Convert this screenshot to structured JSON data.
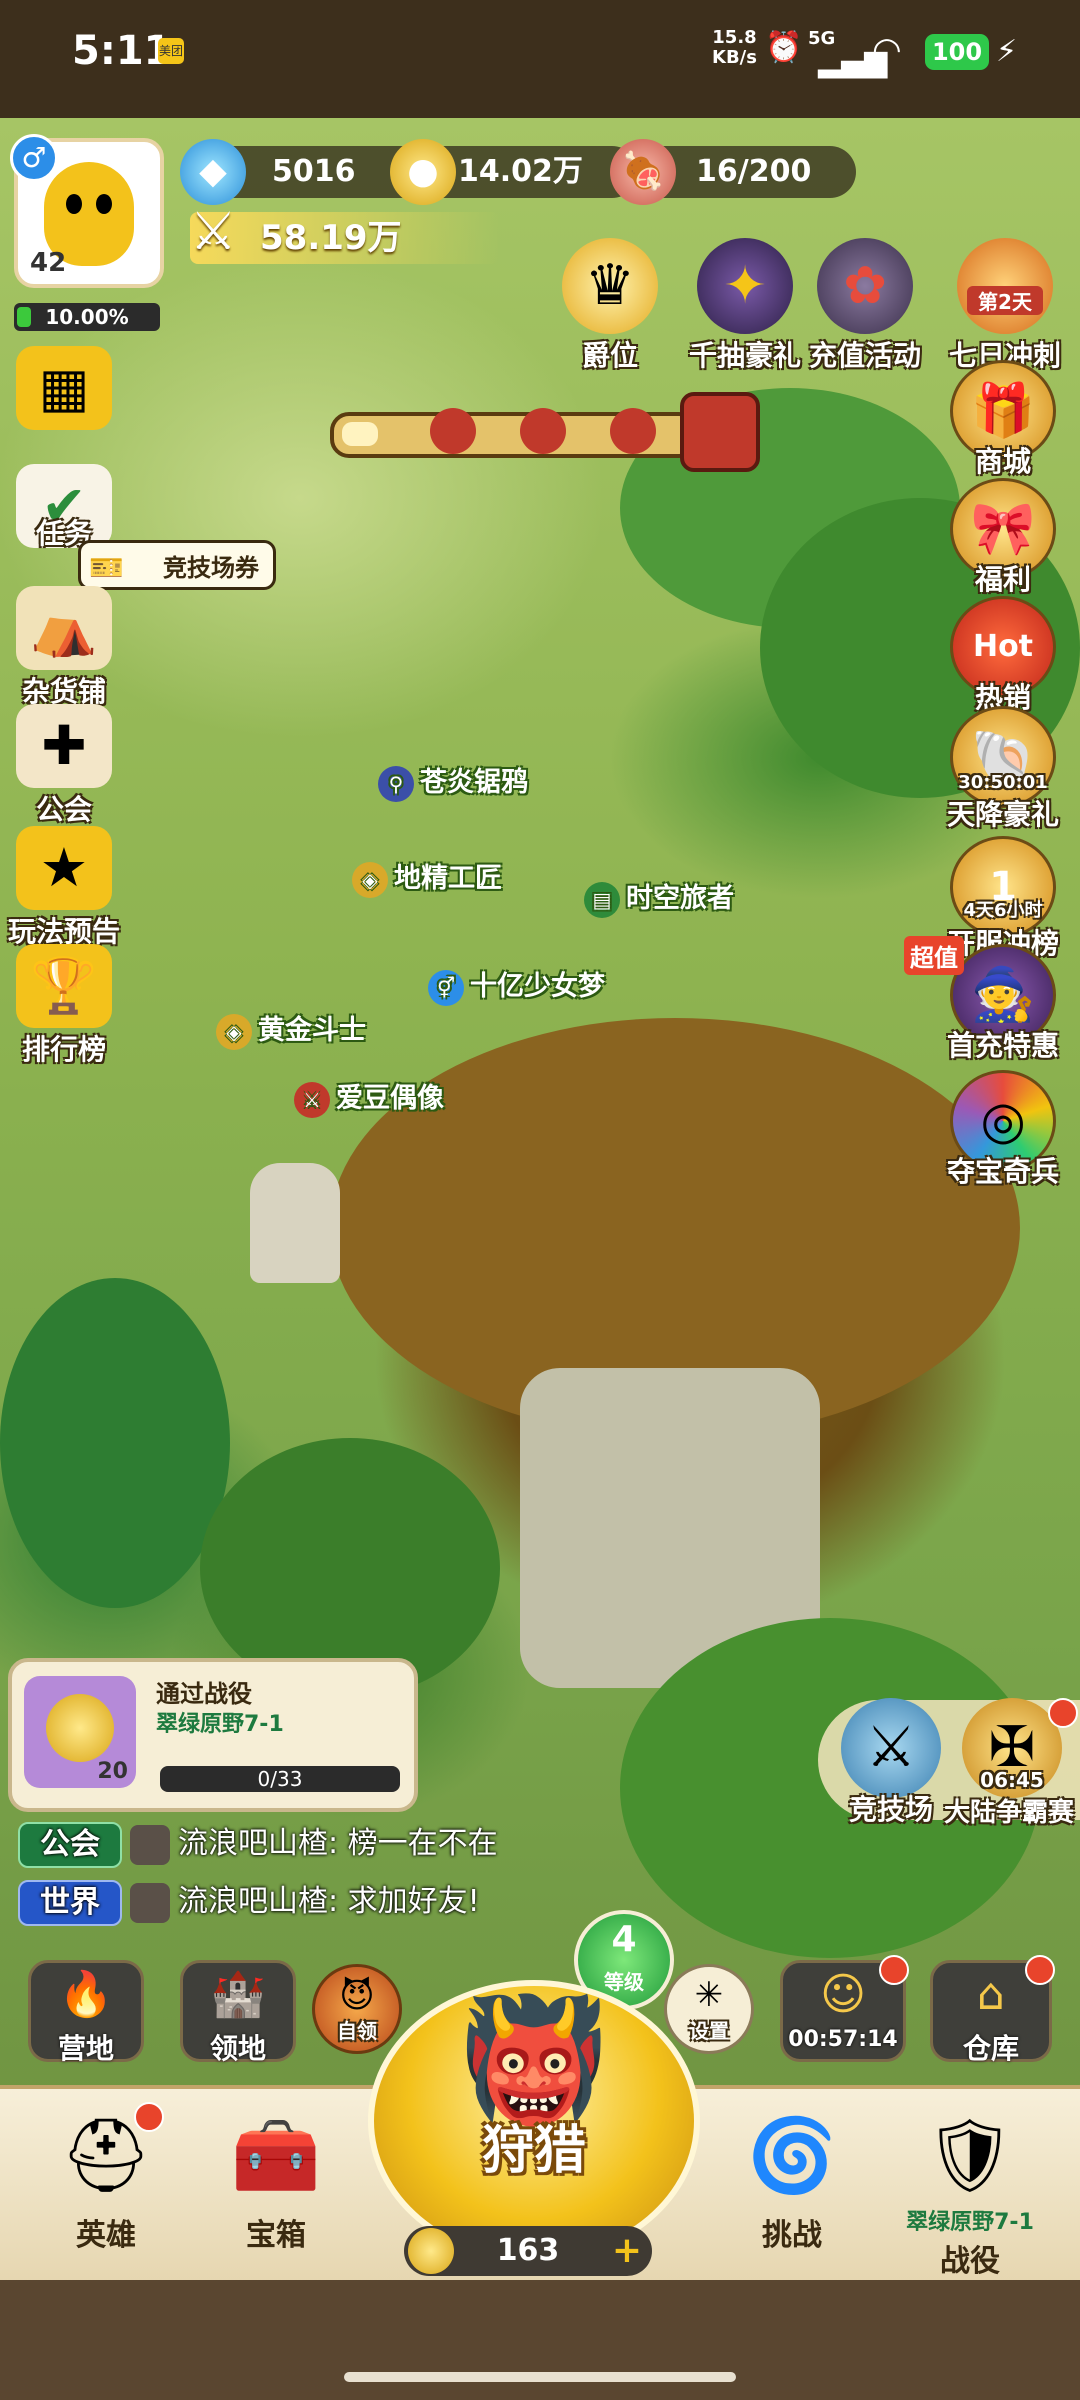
{
  "status_bar": {
    "time": "5:11",
    "app_badge": "美团",
    "net_speed_value": "15.8",
    "net_speed_unit": "KB/s",
    "network": "5G",
    "battery": "100"
  },
  "player": {
    "level": "42",
    "exp_percent": "10.00%",
    "gender_icon": "male-icon"
  },
  "resources": {
    "gems": "5016",
    "gold": "14.02万",
    "stamina": "16/200",
    "power": "58.19万"
  },
  "top_icons": [
    {
      "label": "爵位"
    },
    {
      "label": "千抽豪礼"
    },
    {
      "label": "充值活动"
    },
    {
      "label": "七日冲刺",
      "badge": "第2天"
    }
  ],
  "left_menu": [
    {
      "label": ""
    },
    {
      "label": "任务"
    },
    {
      "label": "杂货铺"
    },
    {
      "label": "公会"
    },
    {
      "label": "玩法预告"
    },
    {
      "label": "排行榜"
    }
  ],
  "arena_ticket_tooltip": "竞技场券",
  "right_menu": [
    {
      "label": "商城"
    },
    {
      "label": "福利"
    },
    {
      "label": "热销",
      "badge": "Hot"
    },
    {
      "label": "天降豪礼",
      "timer": "30:50:01"
    },
    {
      "label": "开服冲榜",
      "timer": "4天6小时",
      "badge": "1"
    },
    {
      "label": "首充特惠",
      "badge": "超值"
    },
    {
      "label": "夺宝奇兵"
    }
  ],
  "npcs": [
    {
      "name": "苍炎锯鸦"
    },
    {
      "name": "地精工匠"
    },
    {
      "name": "时空旅者"
    },
    {
      "name": "十亿少女梦"
    },
    {
      "name": "黄金斗士"
    },
    {
      "name": "爱豆偶像"
    }
  ],
  "quest": {
    "title": "通过战役",
    "target": "翠绿原野7-1",
    "reward": "20",
    "progress_text": "0/33",
    "progress": 0.0
  },
  "chat": [
    {
      "channel": "公会",
      "text": "流浪吧山楂: 榜一在不在"
    },
    {
      "channel": "世界",
      "text": "流浪吧山楂: 求加好友!"
    }
  ],
  "arena_buttons": [
    {
      "label": "竞技场"
    },
    {
      "label": "大陆争霸赛",
      "timer": "06:45"
    }
  ],
  "sub_buttons": {
    "camp": "营地",
    "territory": "领地",
    "auto_claim": "自领",
    "level_value": "4",
    "level_label": "等级",
    "settings": "设置",
    "timer": "00:57:14",
    "warehouse": "仓库"
  },
  "hunt": {
    "label": "狩猎",
    "cost": "163"
  },
  "bottom_nav": [
    {
      "label": "英雄"
    },
    {
      "label": "宝箱"
    },
    {
      "label": "挑战"
    },
    {
      "label": "战役",
      "sublabel": "翠绿原野7-1"
    }
  ],
  "colors": {
    "accent_gold": "#f5c518",
    "badge_red": "#e8442b",
    "exp_green": "#3cc93c",
    "chat_guild": "#1d7a3f",
    "chat_world": "#2556c8"
  }
}
